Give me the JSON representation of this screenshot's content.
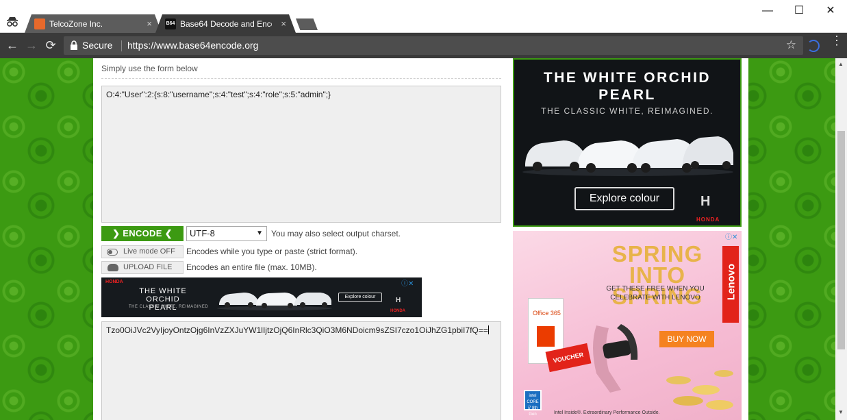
{
  "browser": {
    "tabs": [
      {
        "title": "TelcoZone Inc.",
        "close": "×"
      },
      {
        "title": "Base64 Decode and Enco",
        "close": "×"
      }
    ],
    "window_controls": {
      "minimize": "—",
      "maximize": "☐",
      "close": "✕"
    },
    "nav": {
      "back": "←",
      "forward": "→",
      "reload": "⟳"
    },
    "secure_label": "Secure",
    "url": "https://www.base64encode.org",
    "bookmark_star": "☆",
    "menu": "⋮",
    "favicon_text": "B64"
  },
  "page": {
    "intro": "Simply use the form below",
    "input_text": "O:4:\"User\":2:{s:8:\"username\";s:4:\"test\";s:4:\"role\";s:5:\"admin\";}",
    "encode_button": "ENCODE",
    "charset": "UTF-8",
    "charset_hint": "You may also select output charset.",
    "live_mode_button": "Live mode OFF",
    "live_mode_hint": "Encodes while you type or paste (strict format).",
    "upload_button": "UPLOAD FILE",
    "upload_hint": "Encodes an entire file (max. 10MB).",
    "output_text": "Tzo0OiJVc2VyIjoyOntzOjg6InVzZXJuYW1lIjtzOjQ6InRlc3QiO3M6NDoicm9sZSI7czo1OiJhZG1pbiI7fQ=="
  },
  "ad_strip": {
    "brand": "HONDA",
    "headline": "THE WHITE ORCHID PEARL",
    "tagline": "THE CLASSIC WHITE, REIMAGINED",
    "cta": "Explore colour",
    "logo": "H",
    "logo_word": "HONDA",
    "choices": "ⓘ✕"
  },
  "ad_honda": {
    "headline": "THE WHITE ORCHID PEARL",
    "tagline": "THE CLASSIC WHITE, REIMAGINED.",
    "cta": "Explore colour",
    "logo": "H",
    "logo_word": "HONDA"
  },
  "ad_lenovo": {
    "headline": "SPRING INTO SPRING",
    "sub": "GET THESE FREE WHEN YOU CELEBRATE WITH LENOVO",
    "brand": "Lenovo",
    "cta": "BUY NOW",
    "office": "Office 365",
    "voucher": "VOUCHER",
    "intel_badge": "intel CORE i7 8th Gen",
    "intel_text": "Intel Inside®. Extraordinary Performance Outside.",
    "choices": "ⓘ✕"
  },
  "colors": {
    "accent_green": "#3c9a12",
    "toolbar_dark": "#3a3a3a",
    "honda_red": "#e22222",
    "lenovo_red": "#e2231a",
    "buy_orange": "#f58220"
  }
}
